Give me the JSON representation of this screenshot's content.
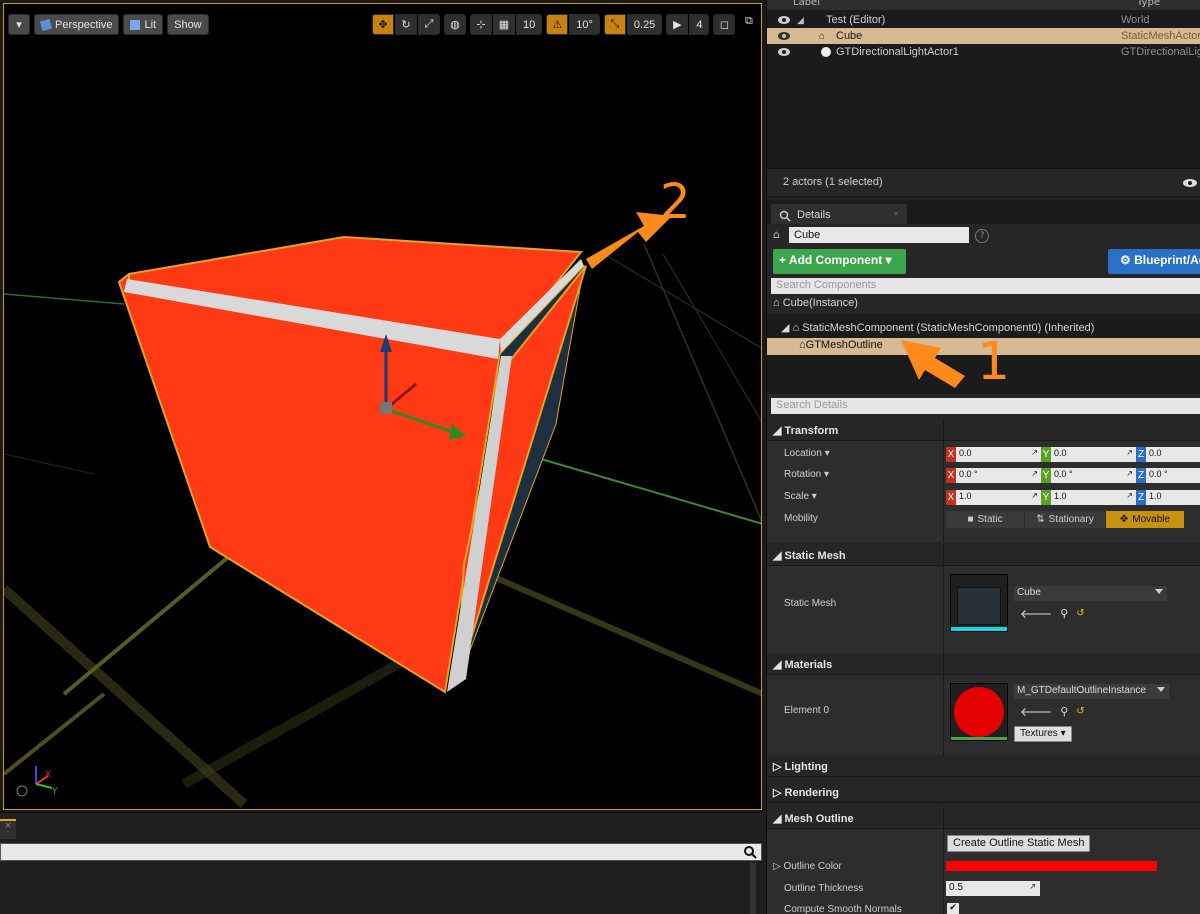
{
  "viewport": {
    "toolbar_left": {
      "perspective_label": "Perspective",
      "lit_label": "Lit",
      "show_label": "Show"
    },
    "toolbar_right": {
      "grid_snap_value": "10",
      "rotation_snap_value": "10°",
      "scale_snap_value": "0.25",
      "camera_speed_value": "4"
    },
    "annotations": [
      "2",
      "1"
    ],
    "colors": {
      "cube_face": "#ff3a12",
      "outline": "#e1a326",
      "grid": "#3fa23a"
    }
  },
  "outliner": {
    "columns": {
      "label": "Label",
      "type": "Type"
    },
    "rows": [
      {
        "label": "Test (Editor)",
        "type": "World",
        "selected": false
      },
      {
        "label": "Cube",
        "type": "StaticMeshActor",
        "selected": true
      },
      {
        "label": "GTDirectionalLightActor1",
        "type": "GTDirectionalLight",
        "selected": false
      }
    ],
    "footer": "2 actors (1 selected)",
    "view_options": "View Options"
  },
  "details": {
    "tab_label": "Details",
    "tab_close": "×",
    "actor_name": "Cube",
    "help": "?",
    "add_component": "+ Add Component ▾",
    "blueprint_script": "Blueprint/Add Script",
    "search_components_placeholder": "Search Components",
    "components": [
      {
        "label": "Cube(Instance)"
      },
      {
        "label": "StaticMeshComponent (StaticMeshComponent0) (Inherited)"
      },
      {
        "label": "GTMeshOutline"
      }
    ],
    "search_details_placeholder": "Search Details",
    "transform": {
      "title": "Transform",
      "location_label": "Location ▾",
      "rotation_label": "Rotation ▾",
      "scale_label": "Scale ▾",
      "mobility_label": "Mobility",
      "location": {
        "x": "0.0",
        "y": "0.0",
        "z": "0.0"
      },
      "rotation": {
        "x": "0.0 °",
        "y": "0.0 °",
        "z": "0.0 °"
      },
      "scale": {
        "x": "1.0",
        "y": "1.0",
        "z": "1.0"
      },
      "mobility_options": [
        "Static",
        "Stationary",
        "Movable"
      ],
      "mobility_selected": "Movable"
    },
    "static_mesh": {
      "title": "Static Mesh",
      "label": "Static Mesh",
      "value": "Cube"
    },
    "materials": {
      "title": "Materials",
      "label": "Element 0",
      "value": "M_GTDefaultOutlineInstance",
      "textures_label": "Textures ▾"
    },
    "lighting_title": "Lighting",
    "rendering_title": "Rendering",
    "mesh_outline": {
      "title": "Mesh Outline",
      "create_button": "Create Outline Static Mesh",
      "color_label": "Outline Color",
      "color_value": "#ff0000",
      "thickness_label": "Outline Thickness",
      "thickness_value": "0.5",
      "smooth_normals_label": "Compute Smooth Normals",
      "smooth_normals_checked": true
    }
  }
}
